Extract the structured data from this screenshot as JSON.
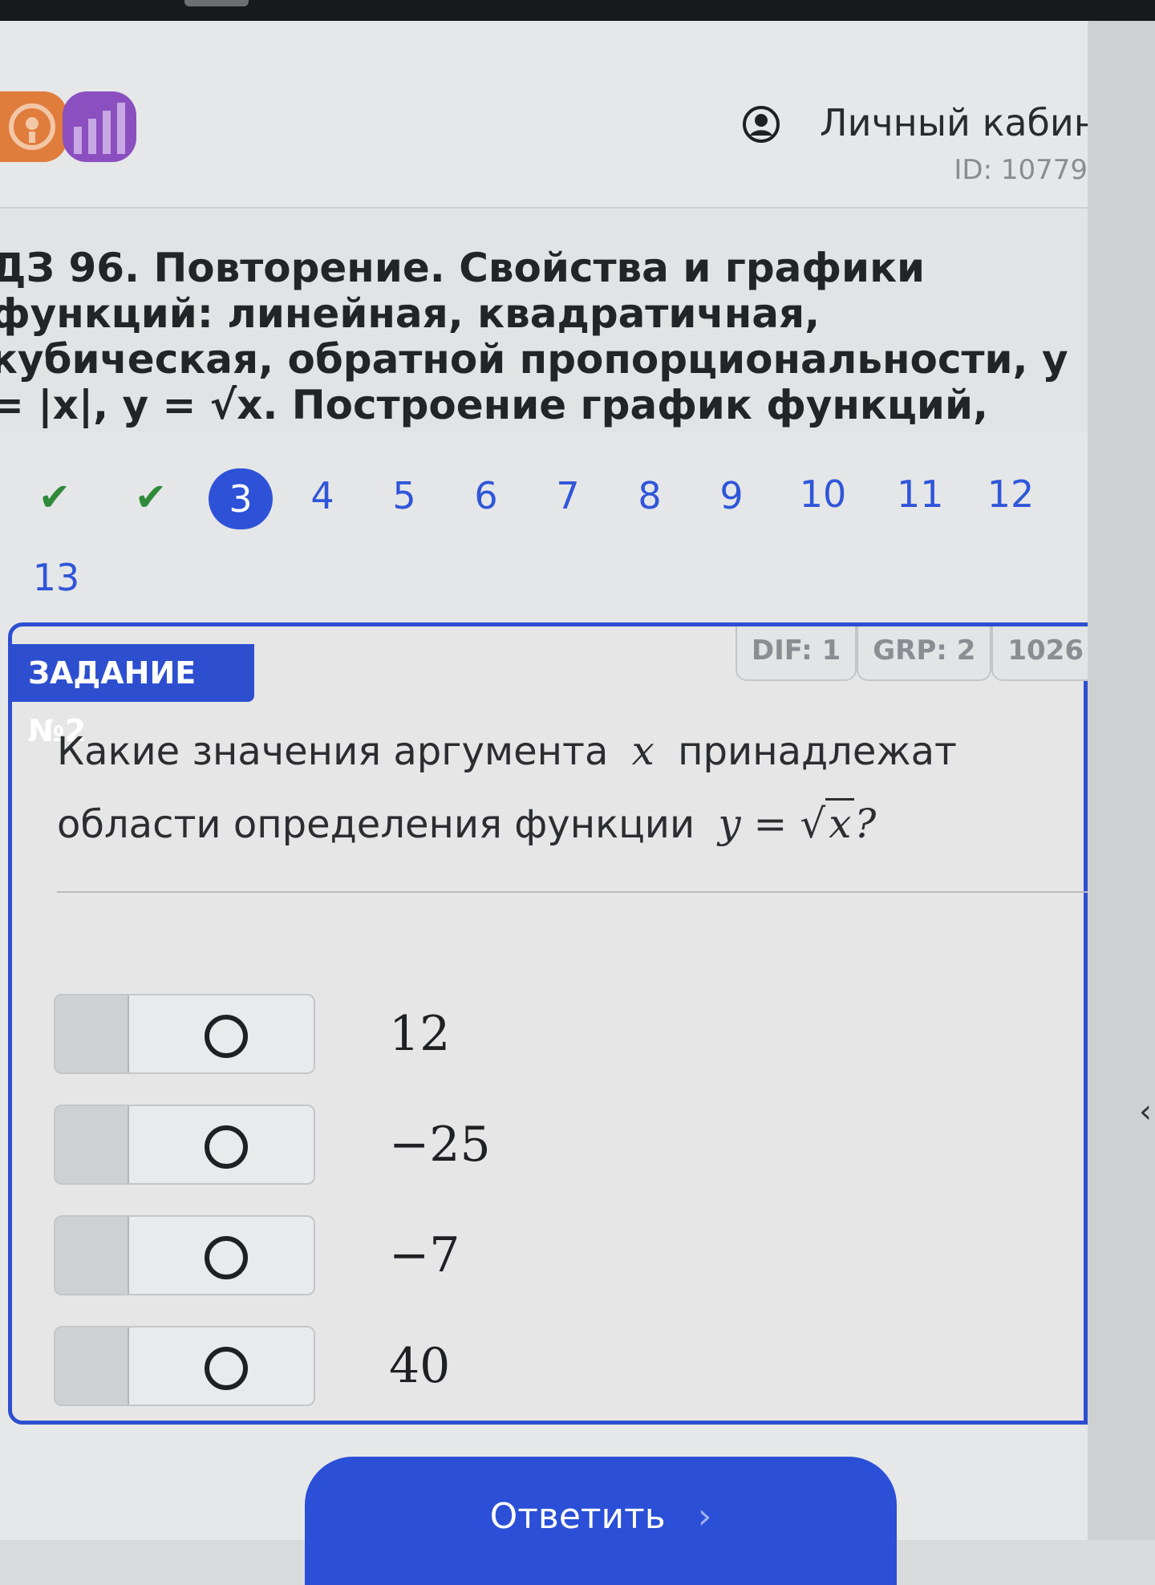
{
  "header": {
    "cabinet_label": "Личный кабин",
    "user_id": "ID: 10779"
  },
  "title": "ДЗ 96. Повторение. Свойства и графики функций: линейная, квадратичная, кубическая, обратной пропорциональности, y = |x|, y = √x. Построение график функций, описание их свойств",
  "pager": {
    "items": [
      "✔",
      "✔",
      "3",
      "4",
      "5",
      "6",
      "7",
      "8",
      "9",
      "10",
      "11",
      "12",
      "13"
    ]
  },
  "task": {
    "label": "ЗАДАНИЕ №2",
    "tags": [
      "DIF: 1",
      "GRP: 2",
      "1026"
    ],
    "question_part1": "Какие значения аргумента",
    "question_var": "x",
    "question_part2": "принадлежат области определения функции",
    "question_math_lhs": "y =",
    "question_math_sqrt": "√",
    "question_math_rad": "x",
    "question_end": "?",
    "options": [
      "12",
      "−25",
      "−7",
      "40"
    ]
  },
  "submit": {
    "label": "Ответить",
    "chevron": "›"
  },
  "colors": {
    "accent": "#2d4fcf",
    "check": "#2f8a3a",
    "page": "#e6e7e8"
  }
}
